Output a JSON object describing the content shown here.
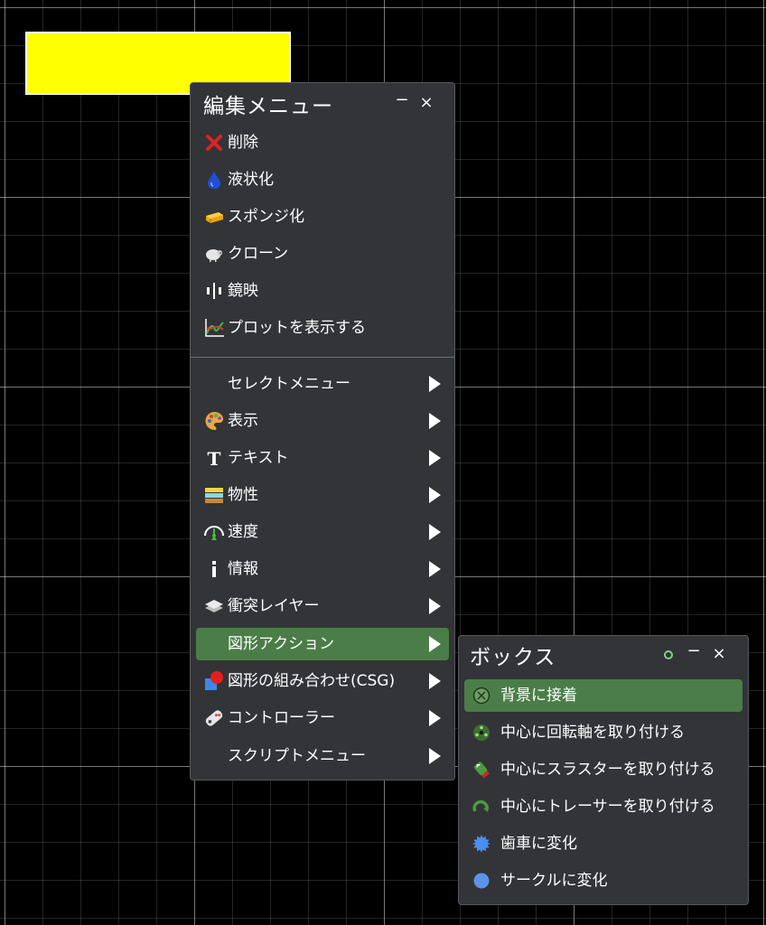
{
  "edit_menu": {
    "title": "編集メニュー",
    "minimize_label": "−",
    "close_label": "×",
    "actions": [
      {
        "label": "削除",
        "icon": "delete-x-icon"
      },
      {
        "label": "液状化",
        "icon": "water-drop-icon"
      },
      {
        "label": "スポンジ化",
        "icon": "sponge-icon"
      },
      {
        "label": "クローン",
        "icon": "sheep-icon"
      },
      {
        "label": "鏡映",
        "icon": "mirror-icon"
      },
      {
        "label": "プロットを表示する",
        "icon": "plot-icon"
      }
    ],
    "submenus": [
      {
        "label": "セレクトメニュー",
        "icon": "none"
      },
      {
        "label": "表示",
        "icon": "palette-icon"
      },
      {
        "label": "テキスト",
        "icon": "text-t-icon"
      },
      {
        "label": "物性",
        "icon": "material-layers-icon"
      },
      {
        "label": "速度",
        "icon": "speedometer-icon"
      },
      {
        "label": "情報",
        "icon": "info-icon"
      },
      {
        "label": "衝突レイヤー",
        "icon": "layers-icon"
      },
      {
        "label": "図形アクション",
        "icon": "none",
        "selected": true
      },
      {
        "label": "図形の組み合わせ(CSG)",
        "icon": "csg-icon"
      },
      {
        "label": "コントローラー",
        "icon": "gamepad-icon"
      },
      {
        "label": "スクリプトメニュー",
        "icon": "none"
      }
    ]
  },
  "box_menu": {
    "title": "ボックス",
    "minimize_label": "−",
    "close_label": "×",
    "items": [
      {
        "label": "背景に接着",
        "icon": "glue-icon",
        "selected": true
      },
      {
        "label": "中心に回転軸を取り付ける",
        "icon": "axle-icon"
      },
      {
        "label": "中心にスラスターを取り付ける",
        "icon": "thruster-icon"
      },
      {
        "label": "中心にトレーサーを取り付ける",
        "icon": "tracer-icon"
      },
      {
        "label": "歯車に変化",
        "icon": "gear-icon"
      },
      {
        "label": "サークルに変化",
        "icon": "circle-icon"
      }
    ]
  },
  "colors": {
    "canvas_bg": "#000000",
    "selected_shape_fill": "#ffff00",
    "panel_bg": "#323438",
    "highlight": "#4b7d48"
  }
}
